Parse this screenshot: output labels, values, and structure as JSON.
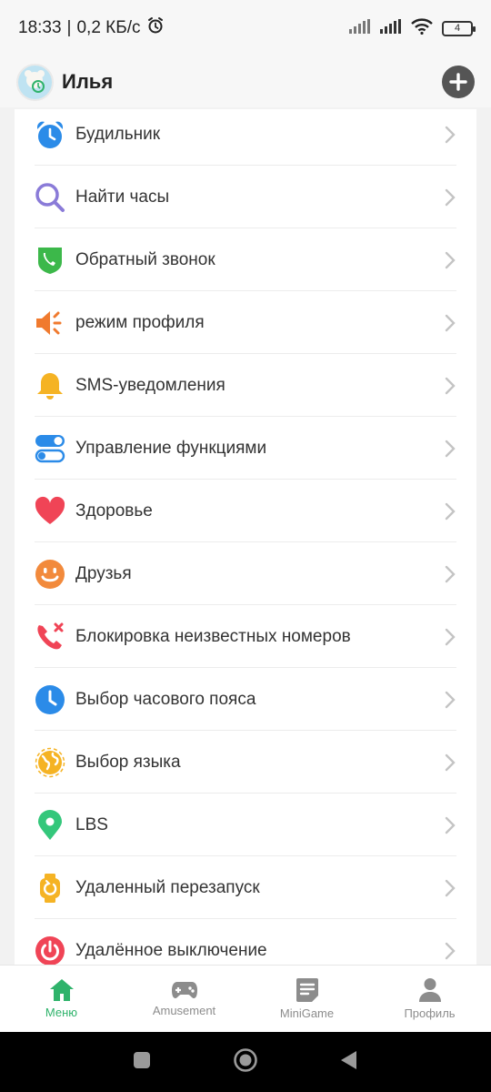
{
  "status_bar": {
    "time": "18:33",
    "separator": "|",
    "speed": "0,2 КБ/с",
    "battery": "4"
  },
  "header": {
    "user_name": "Илья"
  },
  "menu": {
    "items": [
      {
        "label": "Будильник",
        "icon": "alarm-clock-icon",
        "color": "#2b8be8"
      },
      {
        "label": "Найти часы",
        "icon": "search-icon",
        "color": "#8a7bd8"
      },
      {
        "label": "Обратный звонок",
        "icon": "phone-shield-icon",
        "color": "#3cb84a"
      },
      {
        "label": "режим профиля",
        "icon": "speaker-icon",
        "color": "#f07a2e"
      },
      {
        "label": "SMS-уведомления",
        "icon": "bell-icon",
        "color": "#f5b324"
      },
      {
        "label": "Управление функциями",
        "icon": "toggle-icon",
        "color": "#2b8be8"
      },
      {
        "label": "Здоровье",
        "icon": "heart-icon",
        "color": "#f04456"
      },
      {
        "label": "Друзья",
        "icon": "smile-icon",
        "color": "#f28a3c"
      },
      {
        "label": "Блокировка неизвестных номеров",
        "icon": "phone-block-icon",
        "color": "#f04456"
      },
      {
        "label": "Выбор часового пояса",
        "icon": "clock-icon",
        "color": "#2b8be8"
      },
      {
        "label": "Выбор языка",
        "icon": "globe-icon",
        "color": "#f5b324"
      },
      {
        "label": "LBS",
        "icon": "location-pin-icon",
        "color": "#34c77b"
      },
      {
        "label": "Удаленный перезапуск",
        "icon": "watch-restart-icon",
        "color": "#f5b324"
      },
      {
        "label": "Удалённое выключение",
        "icon": "power-icon",
        "color": "#f04456"
      }
    ]
  },
  "bottom_nav": {
    "items": [
      {
        "label": "Меню",
        "icon": "home-icon",
        "active": true
      },
      {
        "label": "Amusement",
        "icon": "gamepad-icon",
        "active": false
      },
      {
        "label": "MiniGame",
        "icon": "document-icon",
        "active": false
      },
      {
        "label": "Профиль",
        "icon": "person-icon",
        "active": false
      }
    ],
    "active_color": "#2fb36b",
    "inactive_color": "#8c8c8c"
  }
}
